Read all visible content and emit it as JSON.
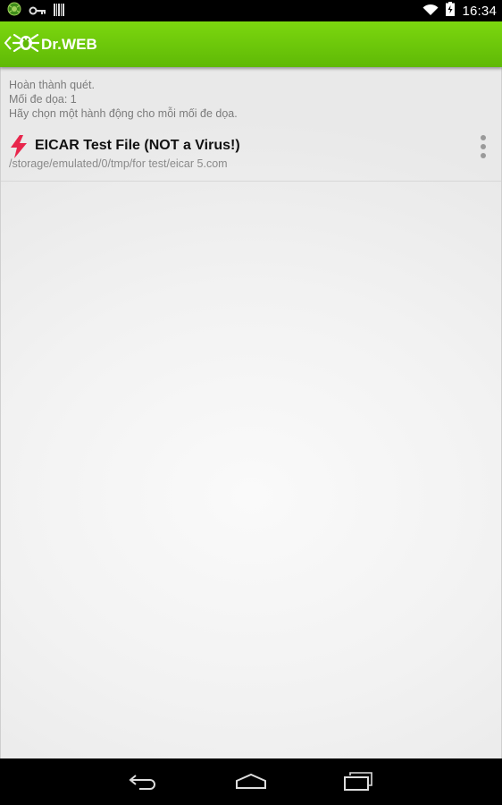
{
  "status_bar": {
    "time": "16:34",
    "icons": [
      "app-notification-icon",
      "key-icon",
      "barcode-icon",
      "wifi-icon",
      "battery-icon"
    ]
  },
  "action_bar": {
    "title": "Dr.WEB",
    "logo_icon": "drweb-spider-icon",
    "up_icon": "chevron-left-icon"
  },
  "summary": {
    "line1": "Hoàn thành quét.",
    "line2": "Mối đe dọa: 1",
    "line3": "Hãy chọn một hành động cho mỗi mối đe dọa."
  },
  "threats": [
    {
      "name": "EICAR Test File (NOT a Virus!)",
      "path": "/storage/emulated/0/tmp/for test/eicar 5.com",
      "icon": "lightning-bolt-icon",
      "menu_icon": "overflow-menu-icon"
    }
  ],
  "nav_bar": {
    "buttons": [
      "back-icon",
      "home-icon",
      "recent-apps-icon"
    ]
  },
  "colors": {
    "action_bar_top": "#7cd70f",
    "action_bar_bottom": "#5fb906",
    "threat_icon": "#e8264c",
    "status_bar": "#000000"
  }
}
